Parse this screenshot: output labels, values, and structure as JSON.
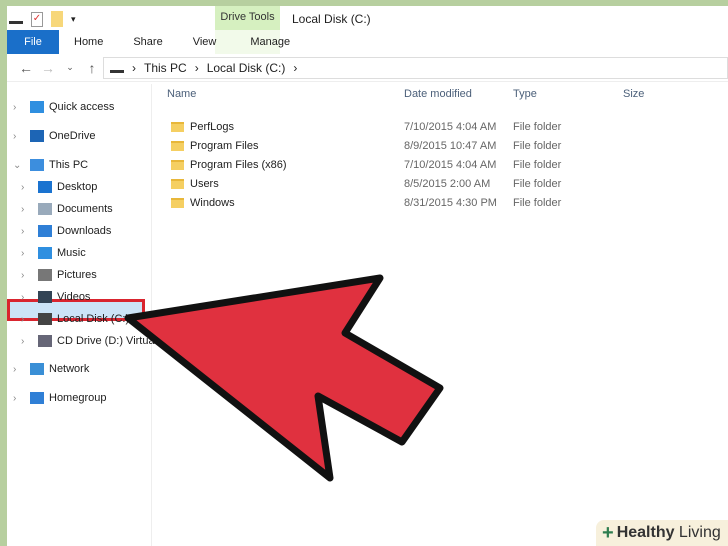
{
  "window": {
    "title": "Local Disk (C:)",
    "context_tab": "Drive Tools"
  },
  "ribbon": {
    "tabs": [
      "File",
      "Home",
      "Share",
      "View",
      "Manage"
    ]
  },
  "address": {
    "crumbs": [
      "This PC",
      "Local Disk (C:)"
    ]
  },
  "sidebar": [
    {
      "label": "Quick access",
      "chev": "›",
      "level": 0
    },
    {
      "label": "OneDrive",
      "chev": "›",
      "level": 0
    },
    {
      "label": "This PC",
      "chev": "⌄",
      "level": 0
    },
    {
      "label": "Desktop",
      "chev": "›",
      "level": 1
    },
    {
      "label": "Documents",
      "chev": "›",
      "level": 1
    },
    {
      "label": "Downloads",
      "chev": "›",
      "level": 1
    },
    {
      "label": "Music",
      "chev": "›",
      "level": 1
    },
    {
      "label": "Pictures",
      "chev": "›",
      "level": 1
    },
    {
      "label": "Videos",
      "chev": "›",
      "level": 1
    },
    {
      "label": "Local Disk (C:)",
      "chev": "›",
      "level": 1
    },
    {
      "label": "CD Drive (D:) Virtua",
      "chev": "›",
      "level": 1
    },
    {
      "label": "Network",
      "chev": "›",
      "level": 0
    },
    {
      "label": "Homegroup",
      "chev": "›",
      "level": 0
    }
  ],
  "columns": [
    "Name",
    "Date modified",
    "Type",
    "Size"
  ],
  "files": [
    {
      "name": "PerfLogs",
      "date": "7/10/2015 4:04 AM",
      "type": "File folder"
    },
    {
      "name": "Program Files",
      "date": "8/9/2015 10:47 AM",
      "type": "File folder"
    },
    {
      "name": "Program Files (x86)",
      "date": "7/10/2015 4:04 AM",
      "type": "File folder"
    },
    {
      "name": "Users",
      "date": "8/5/2015 2:00 AM",
      "type": "File folder"
    },
    {
      "name": "Windows",
      "date": "8/31/2015 4:30 PM",
      "type": "File folder"
    }
  ],
  "watermark": {
    "bold": "Healthy",
    "rest": " Living"
  },
  "colors": {
    "arrow": "#e0313f",
    "highlight": "#d9252f",
    "file_tab": "#1a6fc9"
  }
}
